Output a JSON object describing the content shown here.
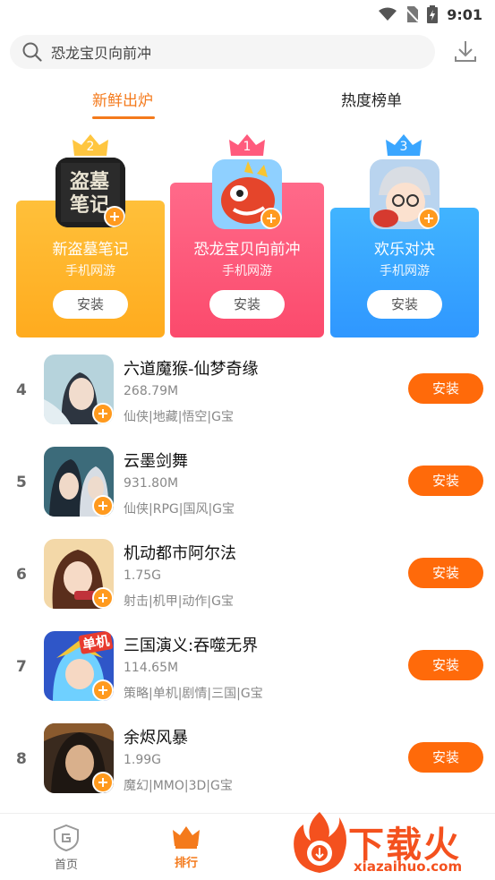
{
  "status_bar": {
    "time": "9:01"
  },
  "search": {
    "text": "恐龙宝贝向前冲"
  },
  "tabs": [
    {
      "label": "新鲜出炉"
    },
    {
      "label": "热度榜单"
    }
  ],
  "podium": [
    {
      "rank": "2",
      "name": "新盗墓笔记",
      "category": "手机网游",
      "button": "安装",
      "icon_text": "盗墓笔记",
      "crown_color": "#ffc640"
    },
    {
      "rank": "1",
      "name": "恐龙宝贝向前冲",
      "category": "手机网游",
      "button": "安装",
      "crown_color": "#ff5b7d"
    },
    {
      "rank": "3",
      "name": "欢乐对决",
      "category": "手机网游",
      "button": "安装",
      "crown_color": "#3aa6ff"
    }
  ],
  "list": [
    {
      "rank": "4",
      "title": "六道魔猴-仙梦奇缘",
      "size": "268.79M",
      "tags": "仙侠|地藏|悟空|G宝",
      "button": "安装"
    },
    {
      "rank": "5",
      "title": "云墨剑舞",
      "size": "931.80M",
      "tags": "仙侠|RPG|国风|G宝",
      "button": "安装"
    },
    {
      "rank": "6",
      "title": "机动都市阿尔法",
      "size": "1.75G",
      "tags": "射击|机甲|动作|G宝",
      "button": "安装"
    },
    {
      "rank": "7",
      "title": "三国演义:吞噬无界",
      "size": "114.65M",
      "tags": "策略|单机|剧情|三国|G宝",
      "button": "安装",
      "icon_banner": "单机"
    },
    {
      "rank": "8",
      "title": "余烬风暴",
      "size": "1.99G",
      "tags": "魔幻|MMO|3D|G宝",
      "button": "安装"
    }
  ],
  "bottom_nav": [
    {
      "label": "首页"
    },
    {
      "label": "排行"
    }
  ],
  "watermark": {
    "brand": "下载火",
    "url": "xiazaihuo.com"
  },
  "colors": {
    "accent": "#f47a1c",
    "install_button": "#ff6a0a"
  }
}
